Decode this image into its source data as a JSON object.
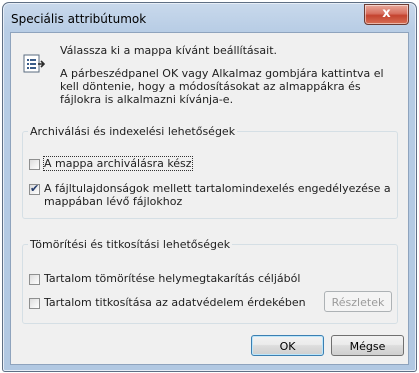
{
  "window": {
    "title": "Speciális attribútumok",
    "close_label": "x"
  },
  "header": {
    "line1": "Válassza ki a mappa kívánt beállításait.",
    "line2": "A párbeszédpanel OK vagy Alkalmaz gombjára kattintva el kell döntenie, hogy a módosításokat az almappákra és fájlokra is alkalmazni kívánja-e."
  },
  "archive_group": {
    "title": "Archiválási és indexelési lehetőségek",
    "archive": {
      "label": "A mappa archiválásra kész",
      "checked": false
    },
    "index": {
      "label": "A fájltulajdonságok mellett tartalomindexelés engedélyezése a mappában lévő fájlokhoz",
      "checked": true
    }
  },
  "compress_group": {
    "title": "Tömörítési és titkosítási lehetőségek",
    "compress": {
      "label": "Tartalom tömörítése helymegtakarítás céljából",
      "checked": false
    },
    "encrypt": {
      "label": "Tartalom titkosítása az adatvédelem érdekében",
      "checked": false
    },
    "details_label": "Részletek"
  },
  "buttons": {
    "ok": "OK",
    "cancel": "Mégse"
  },
  "colors": {
    "accent": "#3c7fb1",
    "close": "#c4432f"
  }
}
